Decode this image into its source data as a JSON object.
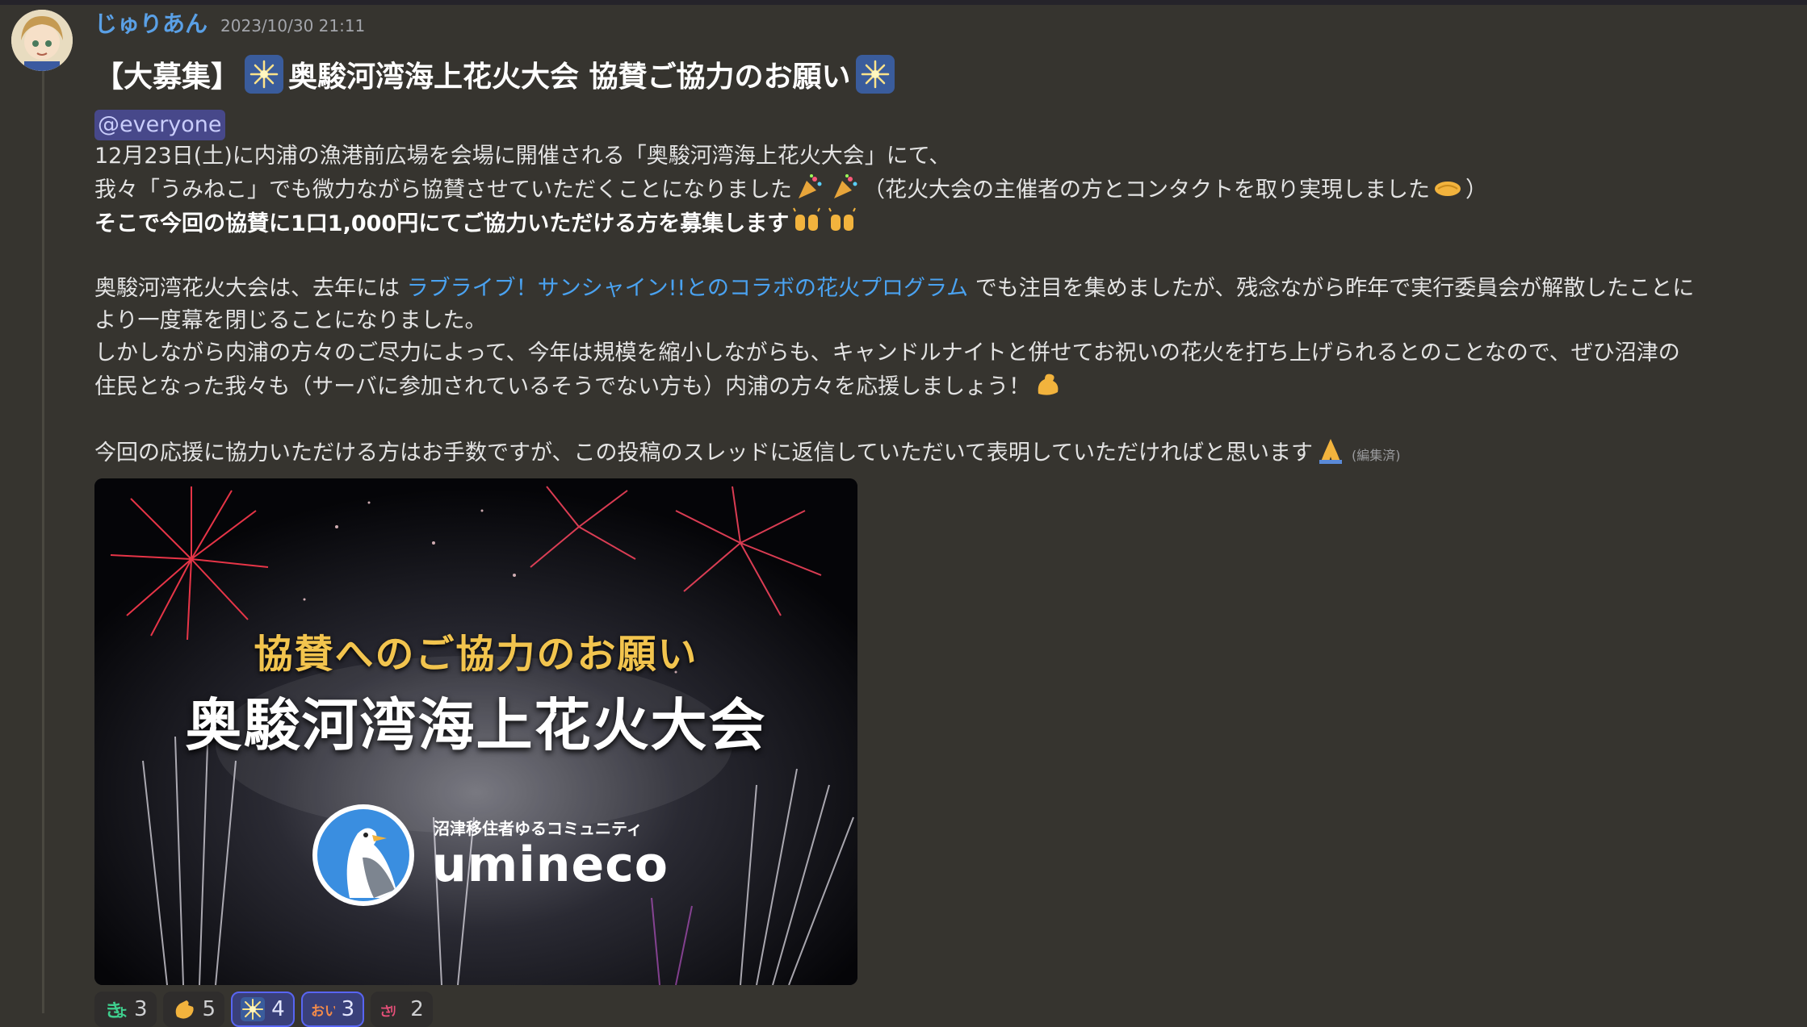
{
  "message": {
    "username": "じゅりあん",
    "timestamp": "2023/10/30 21:11",
    "title": "【大募集】",
    "title_main": "奥駿河湾海上花火大会 協賛ご協力のお願い",
    "mention": "@everyone",
    "line1": "12月23日(土)に内浦の漁港前広場を会場に開催される「奥駿河湾海上花火大会」にて、",
    "line2a": "我々「うみねこ」でも微力ながら協賛させていただくことになりました",
    "line2b": "（花火大会の主催者の方とコンタクトを取り実現しました",
    "line2c": "）",
    "line3": "そこで今回の協賛に1口1,000円にてご協力いただける方を募集します",
    "line4a": "奥駿河湾花火大会は、去年には ",
    "line4_link": "ラブライブ！サンシャイン!!とのコラボの花火プログラム",
    "line4b": " でも注目を集めましたが、残念ながら昨年で実行委員会が解散したことに",
    "line5": "より一度幕を閉じることになりました。",
    "line6": "しかしながら内浦の方々のご尽力によって、今年は規模を縮小しながらも、キャンドルナイトと併せてお祝いの花火を打ち上げられるとのことなので、ぜひ沼津の",
    "line7": "住民となった我々も（サーバに参加されているそうでない方も）内浦の方々を応援しましょう！",
    "line8": "今回の応援に協力いただける方はお手数ですが、この投稿のスレッドに返信していただいて表明していただければと思います",
    "edited": "(編集済)"
  },
  "image": {
    "subtitle": "協賛へのご協力のお願い",
    "title": "奥駿河湾海上花火大会",
    "community": "沼津移住者ゆるコミュニティ",
    "brand": "umineco"
  },
  "reactions": [
    {
      "icon": "custom-kanji-icon",
      "count": "3",
      "active": false
    },
    {
      "icon": "clapping-hands-icon",
      "count": "5",
      "active": false
    },
    {
      "icon": "fireworks-icon",
      "count": "4",
      "active": true
    },
    {
      "icon": "custom-oi-icon",
      "count": "3",
      "active": true
    },
    {
      "icon": "custom-sticker-icon",
      "count": "2",
      "active": false
    }
  ],
  "colors": {
    "background": "#36342f",
    "username": "#5aa0e6",
    "link": "#4aa2f0",
    "mention_bg": "#47488a"
  }
}
